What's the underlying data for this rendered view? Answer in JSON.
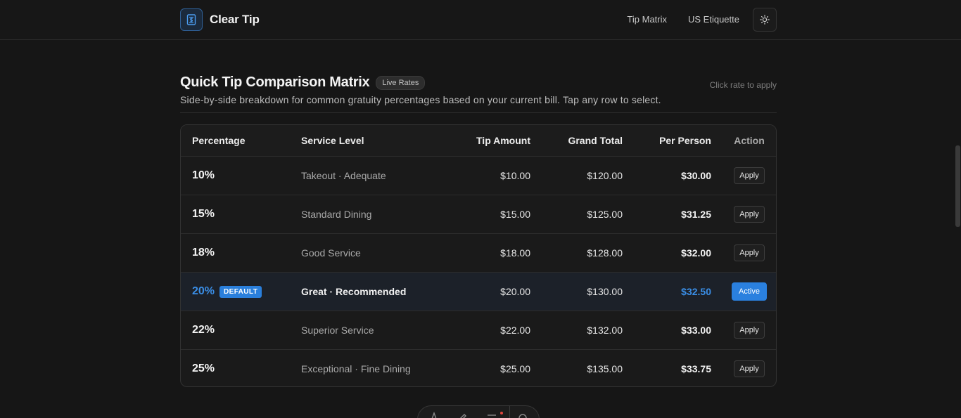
{
  "header": {
    "brand_name": "Clear Tip",
    "nav": [
      "Tip Matrix",
      "US Etiquette"
    ]
  },
  "section": {
    "title": "Quick Tip Comparison Matrix",
    "badge": "Live Rates",
    "hint": "Click rate to apply",
    "description": "Side-by-side breakdown for common gratuity percentages based on your current bill. Tap any row to select."
  },
  "table": {
    "columns": {
      "percentage": "Percentage",
      "service": "Service Level",
      "tip": "Tip Amount",
      "grand": "Grand Total",
      "per_person": "Per Person",
      "action": "Action"
    },
    "rows": [
      {
        "pct": "10%",
        "service": "Takeout · Adequate",
        "tip": "$10.00",
        "grand": "$120.00",
        "per_person": "$30.00",
        "action": "Apply"
      },
      {
        "pct": "15%",
        "service": "Standard Dining",
        "tip": "$15.00",
        "grand": "$125.00",
        "per_person": "$31.25",
        "action": "Apply"
      },
      {
        "pct": "18%",
        "service": "Good Service",
        "tip": "$18.00",
        "grand": "$128.00",
        "per_person": "$32.00",
        "action": "Apply"
      },
      {
        "pct": "20%",
        "badge": "DEFAULT",
        "service": "Great · Recommended",
        "tip": "$20.00",
        "grand": "$130.00",
        "per_person": "$32.50",
        "action": "Active"
      },
      {
        "pct": "22%",
        "service": "Superior Service",
        "tip": "$22.00",
        "grand": "$132.00",
        "per_person": "$33.00",
        "action": "Apply"
      },
      {
        "pct": "25%",
        "service": "Exceptional · Fine Dining",
        "tip": "$25.00",
        "grand": "$135.00",
        "per_person": "$33.75",
        "action": "Apply"
      }
    ]
  },
  "colors": {
    "accent": "#2a80df",
    "background": "#161616"
  },
  "icons": {
    "brand": "receipt-icon",
    "theme": "sun-icon"
  }
}
